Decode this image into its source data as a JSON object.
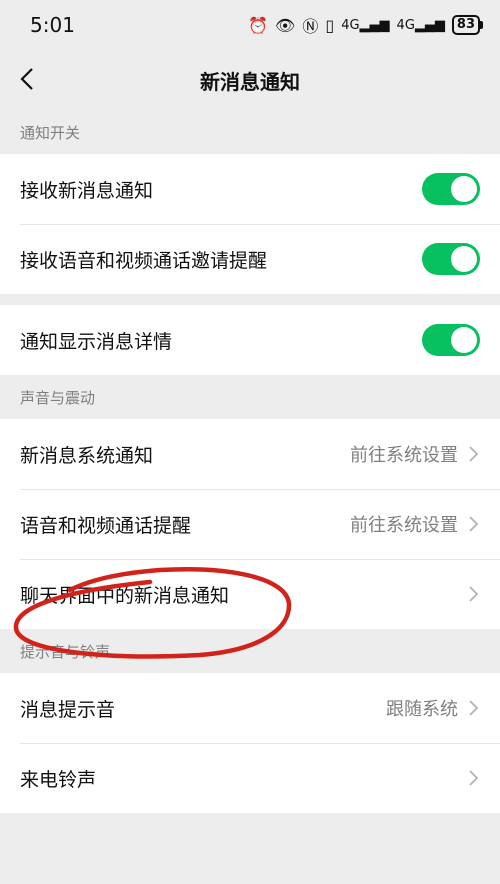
{
  "status_bar": {
    "time": "5:01",
    "icons": [
      "alarm-icon",
      "eye-icon",
      "nfc-icon",
      "vibrate-icon",
      "signal-4g-icon",
      "signal-4g-icon"
    ],
    "signal_1": "4G",
    "signal_2": "4G",
    "battery": "83"
  },
  "nav": {
    "title": "新消息通知"
  },
  "sections": {
    "notify_switch": {
      "header": "通知开关",
      "items": [
        {
          "label": "接收新消息通知",
          "toggle_on": true
        },
        {
          "label": "接收语音和视频通话邀请提醒",
          "toggle_on": true
        }
      ],
      "extra_item": {
        "label": "通知显示消息详情",
        "toggle_on": true
      }
    },
    "sound_vibrate": {
      "header": "声音与震动",
      "items": [
        {
          "label": "新消息系统通知",
          "value": "前往系统设置"
        },
        {
          "label": "语音和视频通话提醒",
          "value": "前往系统设置"
        },
        {
          "label": "聊天界面中的新消息通知",
          "value": ""
        }
      ]
    },
    "tone_ringtone": {
      "header": "提示音与铃声",
      "items": [
        {
          "label": "消息提示音",
          "value": "跟随系统"
        },
        {
          "label": "来电铃声",
          "value": ""
        }
      ]
    }
  },
  "colors": {
    "accent": "#07c160",
    "annotation": "#d2231a",
    "background": "#ededed"
  }
}
